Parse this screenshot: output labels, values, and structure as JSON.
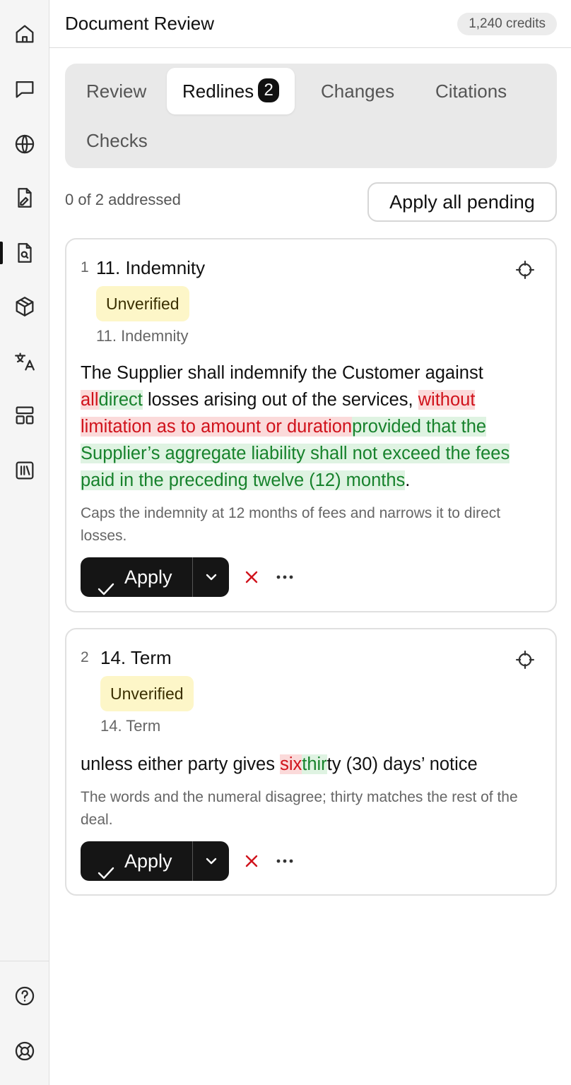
{
  "header": {
    "title": "Document Review",
    "credits": "1,240 credits"
  },
  "rail": {
    "items": [
      {
        "icon": "home-icon"
      },
      {
        "icon": "chat-icon"
      },
      {
        "icon": "globe-icon"
      },
      {
        "icon": "document-edit-icon"
      },
      {
        "icon": "document-search-icon",
        "active": true
      },
      {
        "icon": "cube-icon"
      },
      {
        "icon": "translate-icon"
      },
      {
        "icon": "layout-icon"
      },
      {
        "icon": "library-icon"
      }
    ],
    "bottom": [
      {
        "icon": "help-icon"
      },
      {
        "icon": "support-icon"
      }
    ]
  },
  "tabs": [
    {
      "label": "Review"
    },
    {
      "label": "Redlines",
      "count": "2",
      "active": true
    },
    {
      "label": "Changes"
    },
    {
      "label": "Citations"
    },
    {
      "label": "Checks"
    }
  ],
  "status": {
    "text": "0 of 2 addressed",
    "apply_all_label": "Apply all pending"
  },
  "redlines": [
    {
      "number": "1",
      "title": "11. Indemnity",
      "badge": "Unverified",
      "reference": "11. Indemnity",
      "segments": [
        {
          "type": "text",
          "text": "The Supplier shall indemnify the Customer against "
        },
        {
          "type": "del",
          "text": "all"
        },
        {
          "type": "ins",
          "text": "direct"
        },
        {
          "type": "text",
          "text": " losses arising out of the services, "
        },
        {
          "type": "del",
          "text": "without limitation as to amount or duration"
        },
        {
          "type": "ins",
          "text": "provided that the Supplier’s aggregate liability shall not exceed the fees paid in the preceding twelve (12) months"
        },
        {
          "type": "text",
          "text": "."
        }
      ],
      "note": "Caps the indemnity at 12 months of fees and narrows it to direct losses.",
      "apply_label": "Apply"
    },
    {
      "number": "2",
      "title": "14. Term",
      "badge": "Unverified",
      "reference": "14. Term",
      "segments": [
        {
          "type": "text",
          "text": "unless either party gives "
        },
        {
          "type": "del",
          "text": "six"
        },
        {
          "type": "ins",
          "text": "thir"
        },
        {
          "type": "text",
          "text": "ty (30) days’ notice"
        }
      ],
      "note": "The words and the numeral disagree; thirty matches the rest of the deal.",
      "apply_label": "Apply"
    }
  ],
  "colors": {
    "deleted_text": "#d0121b",
    "deleted_bg": "#fbdada",
    "inserted_text": "#17822c",
    "inserted_bg": "#dff3e2",
    "badge_bg": "#fdf6c8",
    "primary_button": "#151515"
  }
}
